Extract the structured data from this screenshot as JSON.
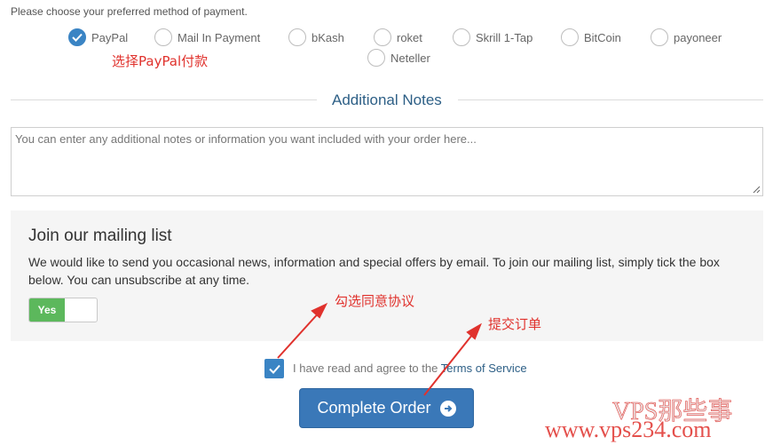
{
  "payment": {
    "prompt": "Please choose your preferred method of payment.",
    "methods": [
      {
        "label": "PayPal",
        "checked": true
      },
      {
        "label": "Mail In Payment",
        "checked": false
      },
      {
        "label": "bKash",
        "checked": false
      },
      {
        "label": "roket",
        "checked": false
      },
      {
        "label": "Skrill 1-Tap",
        "checked": false
      },
      {
        "label": "BitCoin",
        "checked": false
      },
      {
        "label": "payoneer",
        "checked": false
      },
      {
        "label": "Neteller",
        "checked": false
      }
    ]
  },
  "annotations": {
    "select_paypal": "选择PayPal付款",
    "check_agree": "勾选同意协议",
    "submit_order": "提交订单",
    "arrow_color": "#e0322d"
  },
  "notes": {
    "title": "Additional Notes",
    "placeholder": "You can enter any additional notes or information you want included with your order here..."
  },
  "mailing": {
    "title": "Join our mailing list",
    "description": "We would like to send you occasional news, information and special offers by email. To join our mailing list, simply tick the box below. You can unsubscribe at any time.",
    "toggle_label": "Yes"
  },
  "agreement": {
    "checked": true,
    "text": "I have read and agree to the",
    "link": "Terms of Service"
  },
  "submit": {
    "label": "Complete Order",
    "icon": "arrow-circle-right-icon"
  },
  "watermark": {
    "line1": "VPS那些事",
    "line2": "www.vps234.com"
  },
  "colors": {
    "accent": "#3a84c4",
    "button": "#3a78b8",
    "toggle_on": "#5cb85c",
    "annotation": "#e0322d",
    "panel_bg": "#f5f5f5"
  }
}
